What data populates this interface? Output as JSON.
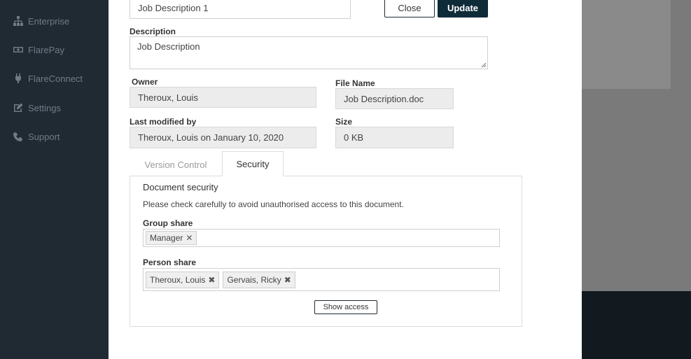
{
  "sidebar": {
    "items": [
      {
        "label": "Enterprise",
        "icon": "sitemap-icon"
      },
      {
        "label": "FlarePay",
        "icon": "money-icon"
      },
      {
        "label": "FlareConnect",
        "icon": "plug-icon"
      },
      {
        "label": "Settings",
        "icon": "edit-icon"
      },
      {
        "label": "Support",
        "icon": "phone-icon"
      }
    ]
  },
  "modal": {
    "title_field_value": "Job Description 1",
    "close_label": "Close",
    "update_label": "Update",
    "description": {
      "label": "Description",
      "value": "Job Description"
    },
    "owner": {
      "label": "Owner",
      "value": "Theroux, Louis"
    },
    "file_name": {
      "label": "File Name",
      "value": "Job Description.doc"
    },
    "last_modified": {
      "label": "Last modified by",
      "value": "Theroux, Louis on January 10, 2020"
    },
    "size": {
      "label": "Size",
      "value": "0 KB"
    },
    "tabs": [
      {
        "label": "Version Control",
        "active": false
      },
      {
        "label": "Security",
        "active": true
      }
    ],
    "security": {
      "title": "Document security",
      "note": "Please check carefully to avoid unauthorised access to this document.",
      "group_share": {
        "label": "Group share",
        "tags": [
          "Manager"
        ]
      },
      "person_share": {
        "label": "Person share",
        "tags": [
          "Theroux, Louis",
          "Gervais, Ricky"
        ]
      },
      "show_access_label": "Show access"
    }
  },
  "colors": {
    "sidebar_bg": "#1f2a33",
    "update_button": "#0e2b38",
    "overlay": "#5c5c5c"
  }
}
